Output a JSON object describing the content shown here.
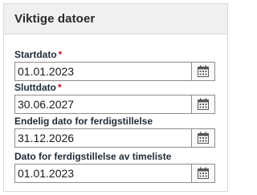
{
  "panel": {
    "title": "Viktige datoer"
  },
  "fields": [
    {
      "label": "Startdato",
      "required_marker": "*",
      "value": "01.01.2023"
    },
    {
      "label": "Sluttdato",
      "required_marker": "*",
      "value": "30.06.2027"
    },
    {
      "label": "Endelig dato for ferdigstillelse",
      "value": "31.12.2026"
    },
    {
      "label": "Dato for ferdigstillelse av timeliste",
      "value": "01.01.2023"
    }
  ],
  "icons": {
    "calendar": "calendar-icon"
  },
  "colors": {
    "header_background": "#f0f0f0",
    "required_marker": "#c8102e",
    "border": "#8c8c8c"
  }
}
